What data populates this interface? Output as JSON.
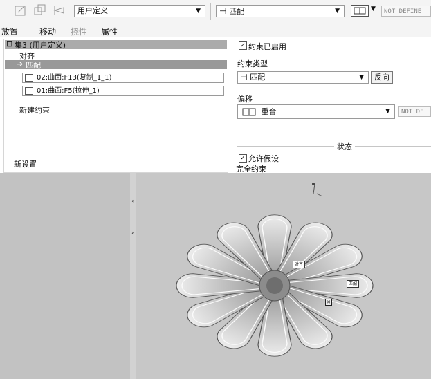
{
  "toolbar": {
    "set_type": "用户定义",
    "constraint_type": "匹配",
    "not_defined_1": "NOT DEFINE",
    "icons": [
      "placement-icon",
      "copy-icon",
      "pin-icon",
      "offset-display-icon"
    ]
  },
  "tabs": [
    {
      "label": "放置",
      "enabled": true
    },
    {
      "label": "移动",
      "enabled": true
    },
    {
      "label": "挠性",
      "enabled": false
    },
    {
      "label": "属性",
      "enabled": true
    }
  ],
  "tree": {
    "set_label": "集3 (用户定义)",
    "align_label": "对齐",
    "match_label": "匹配",
    "ref1": "02:曲面:F13(复制_1_1)",
    "ref2": "01:曲面:F5(拉伸_1)",
    "new_constraint": "新建约束",
    "new_set": "新设置"
  },
  "right": {
    "constraint_enabled": "约束已启用",
    "constraint_type_label": "约束类型",
    "constraint_type_value": "匹配",
    "flip_button": "反向",
    "offset_label": "偏移",
    "offset_value": "重合",
    "not_defined_2": "NOT DE",
    "status_label": "状态",
    "allow_assumptions": "允许假设",
    "fully_constrained": "完全约束"
  },
  "viewport": {
    "tag_align": "对齐",
    "tag_match": "匹配"
  },
  "colors": {
    "panel_bg": "#f4f4f4",
    "selected_row": "#ababab",
    "viewport_bg": "#c7c7c7"
  }
}
